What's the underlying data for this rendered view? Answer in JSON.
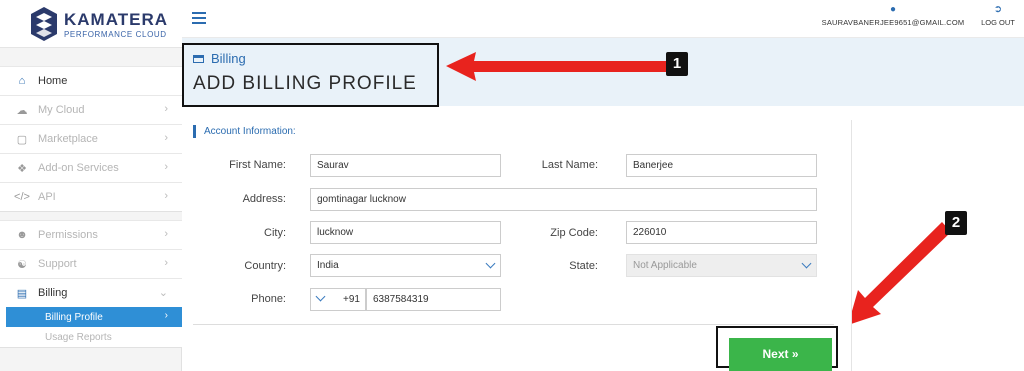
{
  "brand": {
    "name": "KAMATERA",
    "tagline": "PERFORMANCE CLOUD"
  },
  "topbar": {
    "user_email": "SAURAVBANERJEE9651@GMAIL.COM",
    "logout_label": "LOG OUT"
  },
  "sidebar": {
    "items": [
      {
        "label": "Home",
        "icon": "home-icon"
      },
      {
        "label": "My Cloud",
        "icon": "cloud-icon"
      },
      {
        "label": "Marketplace",
        "icon": "cart-icon"
      },
      {
        "label": "Add-on Services",
        "icon": "puzzle-icon"
      },
      {
        "label": "API",
        "icon": "code-icon"
      },
      {
        "label": "Permissions",
        "icon": "users-icon"
      },
      {
        "label": "Support",
        "icon": "headset-icon"
      },
      {
        "label": "Billing",
        "icon": "card-icon"
      }
    ],
    "billing_sub": [
      "Billing Profile",
      "Usage Reports"
    ]
  },
  "header": {
    "breadcrumb": "Billing",
    "title": "ADD BILLING PROFILE"
  },
  "annotations": {
    "badge1": "1",
    "badge2": "2",
    "arrow_color": "#e8231e"
  },
  "form": {
    "section_title": "Account Information:",
    "first_name": {
      "label": "First Name:",
      "value": "Saurav"
    },
    "last_name": {
      "label": "Last Name:",
      "value": "Banerjee"
    },
    "address": {
      "label": "Address:",
      "value": "gomtinagar lucknow"
    },
    "city": {
      "label": "City:",
      "value": "lucknow"
    },
    "zip": {
      "label": "Zip Code:",
      "value": "226010"
    },
    "country": {
      "label": "Country:",
      "value": "India"
    },
    "state": {
      "label": "State:",
      "value": "Not Applicable"
    },
    "phone": {
      "label": "Phone:",
      "code": "+91",
      "value": "6387584319"
    },
    "next_label": "Next »"
  },
  "colors": {
    "accent": "#2b6cb0",
    "selected_nav": "#2f8fd6",
    "next_button": "#3bb54a",
    "header_band": "#e9f2f9"
  }
}
